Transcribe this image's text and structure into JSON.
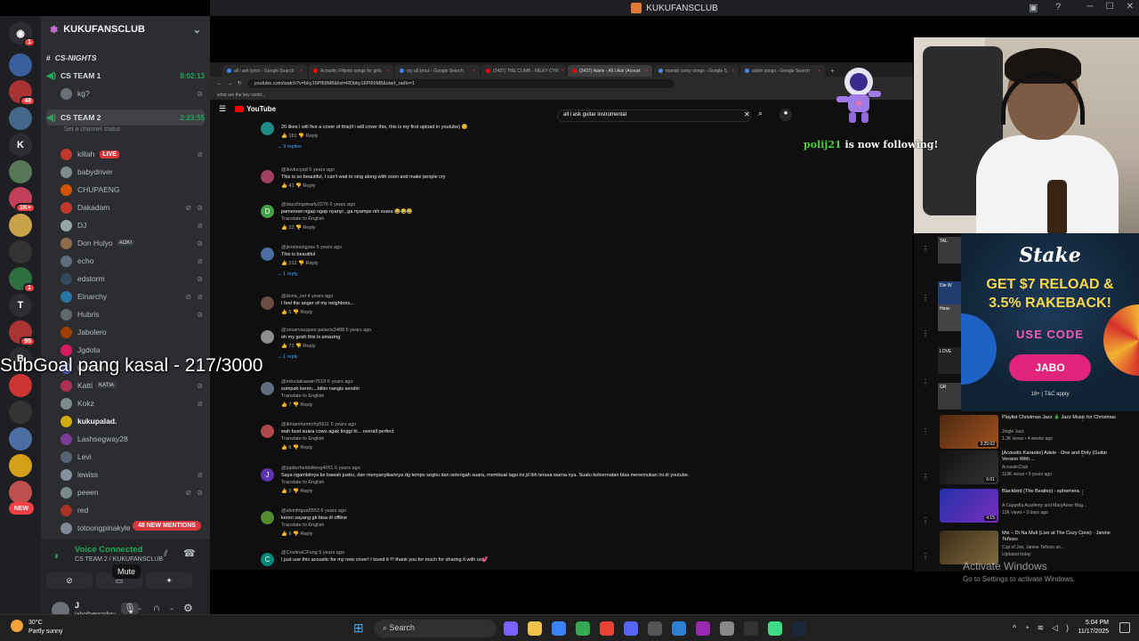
{
  "window": {
    "title": "KUKUFANSCLUB"
  },
  "server_rail": {
    "badges": [
      "1",
      "48",
      "1K+",
      "95",
      "1"
    ],
    "letters": [
      "K",
      "T",
      "B"
    ],
    "new_label": "NEW"
  },
  "sidebar": {
    "guild_name": "KUKUFANSCLUB",
    "category": "CS-NIGHTS",
    "channel1": {
      "name": "CS TEAM 1",
      "time": "8:02:13",
      "member": "kg?"
    },
    "channel2": {
      "name": "CS TEAM 2",
      "time": "2:23:55",
      "status": "Set a channel status"
    },
    "live_label": "LIVE",
    "members": [
      "killah",
      "babydriver",
      "CHUPAENG",
      "Dakadam",
      "DJ",
      "Don Hulyo",
      "echo",
      "edstorm",
      "Einarchy",
      "Hubris",
      "Jabolero",
      "Jgdota",
      "karldota",
      "Katti",
      "Kokz",
      "kukupalad.",
      "Lashsegway28",
      "Levi",
      "lewiss",
      "peeen",
      "red",
      "totoongpinakyle"
    ],
    "tags": {
      "don_hulyo": "AOKI",
      "katti": "KATIA"
    },
    "mentions_badge": "48 NEW MENTIONS"
  },
  "voice": {
    "title": "Voice Connected",
    "sub": "CS TEAM 2 / KUKUFANSCLUB"
  },
  "user": {
    "name": "J",
    "tag": "jabotheprodigy",
    "tooltip": "Mute"
  },
  "overlay": {
    "subgoal": "SubGoal pang kasal - 217/3000",
    "follow_name": "polij21",
    "follow_text": " is now following!"
  },
  "browser": {
    "tabs": [
      "all i ask lyrics - Google Search",
      "Acoustic Filipino songs for girls",
      "my all lyrics - Google Search",
      "(3437) THE CLIMB - MILEY CYR",
      "(3437) Adele - All I Ask (Acoust",
      "mariah carey songs - Google S",
      "adele songs - Google Search"
    ],
    "url": "youtube.com/watch?v=bky16Pl69M8&list=RDbky16Pl69M8&start_radio=1",
    "bookmark": "what are the key contri...",
    "yt_logo": "YouTube",
    "search_query": "all i ask guitar instrumental"
  },
  "comments": [
    {
      "author": "",
      "text": "20 likes i will five a cover of this(if i will cover this, this is my first upload in youtube) 😊",
      "likes": "181",
      "replies": "3 replies",
      "trans": "",
      "initial": ""
    },
    {
      "author": "@iluvlucyad 5 years ago",
      "text": "This is so beautiful, I can't wait to sing along with soon and make people cry",
      "likes": "41",
      "replies": "",
      "trans": "",
      "initial": ""
    },
    {
      "author": "@dazzlingdearly2276 6 years ago",
      "text": "pamerean ngap ngap nyanyi , ga nyampe nih suara 😂😂😂",
      "likes": "22",
      "replies": "",
      "trans": "Translate to English",
      "initial": "D"
    },
    {
      "author": "@jessiesingsss 5 years ago",
      "text": "This is beautiful",
      "likes": "212",
      "replies": "1 reply",
      "trans": "",
      "initial": ""
    },
    {
      "author": "@doria_cel 4 years ago",
      "text": "I feel the anger of my neighbors...",
      "likes": "5",
      "replies": "",
      "trans": "",
      "initial": ""
    },
    {
      "author": "@cesarvasquez-palacio3488 5 years ago",
      "text": "oh my gosh this is amazing",
      "likes": "71",
      "replies": "1 reply",
      "trans": "",
      "initial": ""
    },
    {
      "author": "@edoctakawan7518 6 years ago",
      "text": "sumpah keren....bikin nangis sendiri",
      "likes": "7",
      "replies": "",
      "trans": "Translate to English",
      "initial": ""
    },
    {
      "author": "@ikhiamhamtchy5511 5 years ago",
      "text": "wah bust suara cowo agak tinggi hi... overall perfect",
      "likes": "6",
      "replies": "",
      "trans": "Translate to English",
      "initial": ""
    },
    {
      "author": "@jupiterheidelberg4051 6 years ago",
      "text": "Saya ngambilnya ke bawah justru, dan menyanyikannya dg tempo segitu dan setengah suara, membuat lagu ini jd lbh terasa warna nya. Suatu kehormatan bisa menemukan ini di youtube.",
      "likes": "2",
      "replies": "",
      "trans": "Translate to English",
      "initial": "J"
    },
    {
      "author": "@alvinfrigua5553 6 years ago",
      "text": "keren sayang gk bisa di offline",
      "likes": "6",
      "replies": "",
      "trans": "Translate to English",
      "initial": ""
    },
    {
      "author": "@CristinaCFung 5 years ago",
      "text": "I just use this acoustic for my new cover! I loved it !!! thank you for much for sharing it with us💕",
      "likes": "",
      "replies": "",
      "trans": "",
      "initial": "C"
    }
  ],
  "reply_label": "Reply",
  "ad": {
    "brand": "Stake",
    "headline_1": "GET $7 RELOAD &",
    "headline_2": "3.5% RAKEBACK!",
    "use": "USE CODE",
    "code": "JABO",
    "tc": "18+ | T&C apply"
  },
  "recs": [
    {
      "title": "Playlist Christmas Jazz 🎄 Jazz Music for Christmas",
      "channel": "Jingle Jazz",
      "meta": "1.3K views • 4 weeks ago",
      "duration": "3:25:02"
    },
    {
      "title": "[Acoustic Karaoke] Adele - One and Only (Guitar Version With ...",
      "channel": "AcousticClub",
      "meta": "119K views • 5 years ago",
      "duration": "6:01"
    },
    {
      "title": "Blackbird (The Beatles) - ephemera",
      "channel": "A Cappella Academy and MaryAnne Mug...",
      "meta": "13K views • 3 days ago",
      "duration": "4:15"
    },
    {
      "title": "Mix – Di Na Muli (Live at The Cozy Cove) - Janine Teñoso",
      "channel": "Cup of Joe, Janine Teñoso an...",
      "meta": "Updated today",
      "duration": ""
    }
  ],
  "left_thumbs": [
    "TAL",
    "Die W",
    "Heav",
    "LOVE",
    "GR"
  ],
  "activate": {
    "line1": "Activate Windows",
    "line2": "Go to Settings to activate Windows."
  },
  "taskbar": {
    "temp": "30°C",
    "weather": "Partly sunny",
    "search": "Search",
    "time": "5:04 PM",
    "date": "11/17/2025"
  },
  "colors": {
    "discord_green": "#23a55a",
    "live_red": "#da373c",
    "yt_red": "#ff0000",
    "ad_code": "#e0247b"
  }
}
